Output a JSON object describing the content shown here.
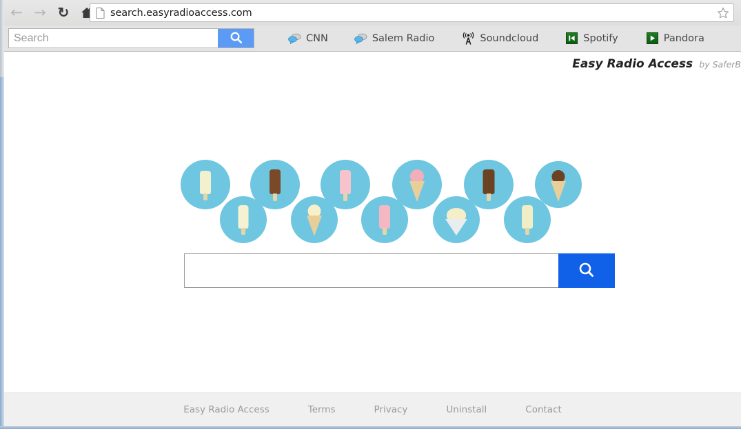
{
  "browser": {
    "nav": {
      "back_icon": "arrow-left-icon",
      "forward_icon": "arrow-right-icon",
      "reload_icon": "reload-icon",
      "home_icon": "home-icon"
    },
    "omnibox": {
      "url": "search.easyradioaccess.com",
      "page_icon": "page-document-icon",
      "star_icon": "star-bookmark-icon"
    }
  },
  "toolbar": {
    "search_placeholder": "Search",
    "search_value": "",
    "search_button_icon": "search-icon",
    "search_button_color": "#5b9bf5",
    "bookmarks": [
      {
        "label": "CNN",
        "icon": "speech-bubbles-icon"
      },
      {
        "label": "Salem Radio",
        "icon": "speech-bubbles-icon"
      },
      {
        "label": "Soundcloud",
        "icon": "radio-tower-icon"
      },
      {
        "label": "Spotify",
        "icon": "previous-track-icon"
      },
      {
        "label": "Pandora",
        "icon": "play-icon"
      }
    ]
  },
  "page": {
    "brand": {
      "name": "Easy Radio Access",
      "by": "by SaferB"
    },
    "search": {
      "value": "",
      "placeholder": "",
      "button_icon": "search-icon",
      "button_color": "#1160e8"
    },
    "icon_cluster": {
      "bubble_color": "#6ec6e0",
      "items": [
        {
          "name": "popsicle-cream",
          "type": "popsicle",
          "color": "#f2f0cd"
        },
        {
          "name": "popsicle-vanilla-ridged",
          "type": "popsicle",
          "color": "#f4f2d2"
        },
        {
          "name": "popsicle-chocolate",
          "type": "popsicle",
          "color": "#7a4a28"
        },
        {
          "name": "cone-vanilla",
          "type": "cone",
          "color": "#f7f0c8"
        },
        {
          "name": "popsicle-strawberry",
          "type": "popsicle",
          "color": "#f6c3cd"
        },
        {
          "name": "popsicle-pink",
          "type": "popsicle",
          "color": "#f3b8c4"
        },
        {
          "name": "cone-strawberry",
          "type": "cone",
          "color": "#f3aebb"
        },
        {
          "name": "cup-vanilla",
          "type": "cup",
          "color": "#f4efc9"
        },
        {
          "name": "popsicle-chocolate-bar",
          "type": "popsicle",
          "color": "#6b4324"
        },
        {
          "name": "popsicle-lemon",
          "type": "popsicle",
          "color": "#f0eec6"
        },
        {
          "name": "cone-chocolate",
          "type": "cone",
          "color": "#6b4324"
        }
      ]
    },
    "footer_links": [
      "Easy Radio Access",
      "Terms",
      "Privacy",
      "Uninstall",
      "Contact"
    ]
  }
}
